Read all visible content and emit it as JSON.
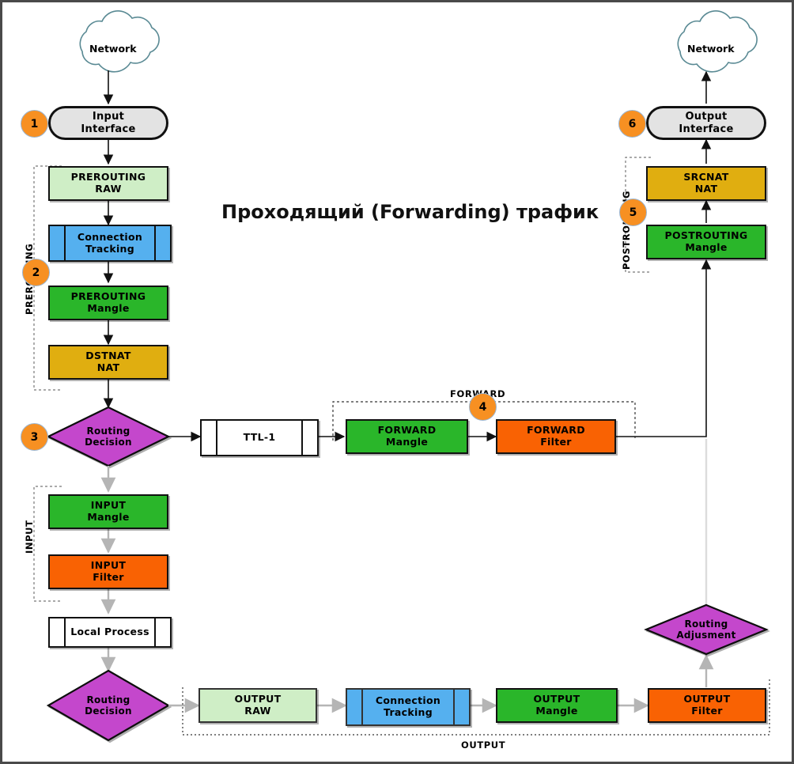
{
  "title": "Проходящий (Forwarding) трафик",
  "colors": {
    "raw": "#cfeec6",
    "conntrack": "#55b0ef",
    "mangle": "#2ab62a",
    "nat": "#e0ae10",
    "filter": "#f96203",
    "diamond": "#c447cc",
    "interface": "#e3e3e3",
    "process": "#ffffff",
    "badge": "#F79022",
    "cloud_stroke": "#5a8a94",
    "arrow_black": "#111111",
    "arrow_gray": "#b5b5b5"
  },
  "clouds": [
    {
      "id": "cloud-in",
      "label": "Network"
    },
    {
      "id": "cloud-out",
      "label": "Network"
    }
  ],
  "interfaces": [
    {
      "id": "input-interface",
      "label": "Input\nInterface"
    },
    {
      "id": "output-interface",
      "label": "Output\nInterface"
    }
  ],
  "badges": [
    {
      "n": "1"
    },
    {
      "n": "2"
    },
    {
      "n": "3"
    },
    {
      "n": "4"
    },
    {
      "n": "5"
    },
    {
      "n": "6"
    }
  ],
  "group_labels": {
    "prerouting": "PREROUTING",
    "postrouting": "POSTROUTING",
    "input": "INPUT",
    "forward": "FORWARD",
    "output": "OUTPUT"
  },
  "chains": {
    "prerouting_raw": "PREROUTING\nRAW",
    "conntrack_in": "Connection\nTracking",
    "prerouting_mangle": "PREROUTING\nMangle",
    "dstnat": "DSTNAT\nNAT",
    "routing_decision_1": "Routing\nDecision",
    "ttl": "TTL-1",
    "forward_mangle": "FORWARD\nMangle",
    "forward_filter": "FORWARD\nFilter",
    "input_mangle": "INPUT\nMangle",
    "input_filter": "INPUT\nFilter",
    "local_process": "Local Process",
    "routing_decision_2": "Routing\nDecision",
    "output_raw": "OUTPUT\nRAW",
    "conntrack_out": "Connection\nTracking",
    "output_mangle": "OUTPUT\nMangle",
    "output_filter": "OUTPUT\nFilter",
    "routing_adjusment": "Routing\nAdjusment",
    "postrouting_mangle": "POSTROUTING\nMangle",
    "srcnat": "SRCNAT\nNAT"
  }
}
